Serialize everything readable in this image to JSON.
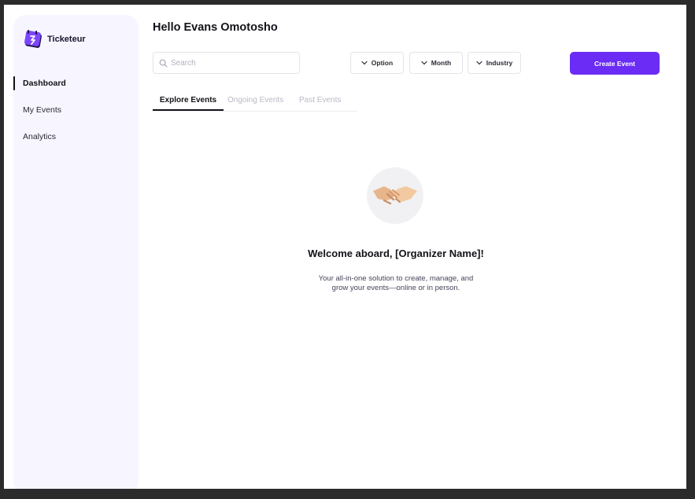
{
  "brand": {
    "name": "Ticketeur",
    "accent": "#6b2cf5"
  },
  "sidebar": {
    "items": [
      {
        "label": "Dashboard",
        "active": true
      },
      {
        "label": "My Events",
        "active": false
      },
      {
        "label": "Analytics",
        "active": false
      }
    ]
  },
  "header": {
    "greeting": "Hello Evans Omotosho"
  },
  "toolbar": {
    "search_placeholder": "Search",
    "search_value": "",
    "filters": [
      {
        "label": "Option",
        "icon": "chevron-down-icon"
      },
      {
        "label": "Month",
        "icon": "chevron-down-icon"
      },
      {
        "label": "Industry",
        "icon": "chevron-down-icon"
      }
    ],
    "create_label": "Create Event"
  },
  "tabs": [
    {
      "label": "Explore Events",
      "active": true
    },
    {
      "label": "Ongoing Events",
      "active": false
    },
    {
      "label": "Past Events",
      "active": false
    }
  ],
  "empty_state": {
    "icon": "handshake-icon",
    "title": "Welcome aboard, [Organizer Name]!",
    "subtitle_line1": "Your all-in-one solution to create, manage, and",
    "subtitle_line2": "grow your events—online or in person."
  }
}
